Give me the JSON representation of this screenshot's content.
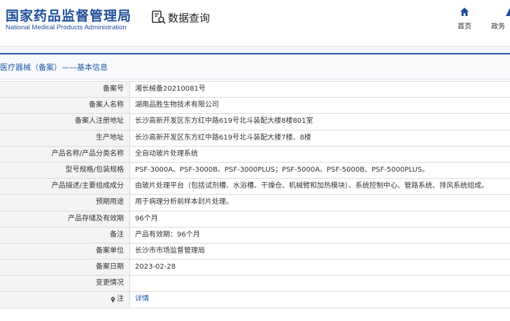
{
  "header": {
    "logo_cn": "国家药品监督管理局",
    "logo_en": "National Medical Products Administration",
    "query_label": "数据查询",
    "nav": [
      {
        "label": "首页",
        "icon": "home-icon"
      },
      {
        "label": "政务",
        "icon": "triangle-icon"
      }
    ]
  },
  "section": {
    "title": "医疗器械（备案）——基本信息"
  },
  "rows": [
    {
      "label": "备案号",
      "value": "湘长械备20210081号"
    },
    {
      "label": "备案人名称",
      "value": "湖南品胜生物技术有限公司"
    },
    {
      "label": "备案人注册地址",
      "value": "长沙高新开发区东方红中路619号北斗装配大楼8楼801室"
    },
    {
      "label": "生产地址",
      "value": "长沙高新开发区东方红中路619号北斗装配大楼7楼、8楼"
    },
    {
      "label": "产品名称/产品分类名称",
      "value": "全自动玻片处理系统"
    },
    {
      "label": "型号规格/包装规格",
      "value": "PSF-3000A、PSF-3000B、PSF-3000PLUS；PSF-5000A、PSF-5000B、PSF-5000PLUS。"
    },
    {
      "label": "产品描述/主要组成成分",
      "value": "由玻片处理平台（包括试剂槽、水浴槽、干燥仓、机械臂和加热模块）、系统控制中心、管路系统、排风系统组成。"
    },
    {
      "label": "预期用途",
      "value": "用于病理分析前样本封片处理。"
    },
    {
      "label": "产品存储及有效期",
      "value": "96个月"
    },
    {
      "label": "备注",
      "value": "产品有效期：96个月"
    },
    {
      "label": "备案单位",
      "value": "长沙市市场监督管理局"
    },
    {
      "label": "备案日期",
      "value": "2023-02-28"
    },
    {
      "label": "变更情况",
      "value": ""
    },
    {
      "label": "注",
      "value": "详情"
    }
  ],
  "colors": {
    "brand_blue": "#1f4f9a",
    "link_blue": "#1e5aa8",
    "label_bg": "#f3f4f6"
  }
}
